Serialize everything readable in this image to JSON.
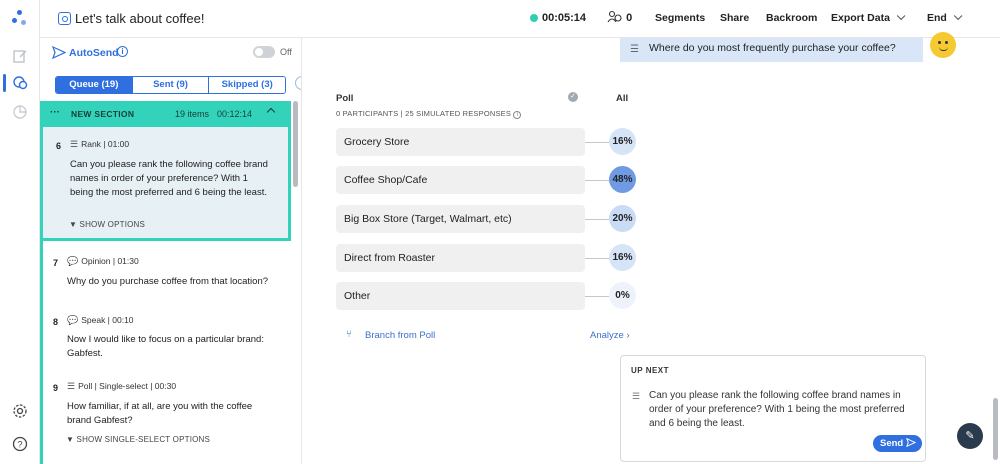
{
  "header": {
    "title": "Let's talk about coffee!",
    "timer": "00:05:14",
    "participants": "0",
    "nav": [
      "Segments",
      "Share",
      "Backroom",
      "Export Data",
      "End"
    ]
  },
  "autosend": {
    "label": "AutoSend",
    "toggle_label": "Off"
  },
  "tabs": [
    "Queue (19)",
    "Sent (9)",
    "Skipped (3)"
  ],
  "section": {
    "name": "NEW SECTION",
    "items": "19 items",
    "time": "00:12:14"
  },
  "questions": [
    {
      "num": "6",
      "meta": "Rank | 01:00",
      "text": "Can you please rank the following coffee brand names in order of your preference? With 1 being the most preferred and 6 being the least.",
      "options": "▼ SHOW OPTIONS"
    },
    {
      "num": "7",
      "meta": "Opinion | 01:30",
      "text": "Why do you purchase coffee from that location?"
    },
    {
      "num": "8",
      "meta": "Speak | 00:10",
      "text": "Now I would like to focus on a particular brand: Gabfest."
    },
    {
      "num": "9",
      "meta": "Poll | Single-select | 00:30",
      "text": "How familiar, if at all, are you with the coffee brand Gabfest?",
      "options": "▼ SHOW SINGLE-SELECT OPTIONS"
    }
  ],
  "chat": {
    "question": "Where do you most frequently purchase your coffee?"
  },
  "poll": {
    "label": "Poll",
    "all_label": "All",
    "subtitle": "0 PARTICIPANTS | 25 SIMULATED RESPONSES",
    "options": [
      {
        "label": "Grocery Store",
        "pct": "16%"
      },
      {
        "label": "Coffee Shop/Cafe",
        "pct": "48%"
      },
      {
        "label": "Big Box Store (Target, Walmart, etc)",
        "pct": "20%"
      },
      {
        "label": "Direct from Roaster",
        "pct": "16%"
      },
      {
        "label": "Other",
        "pct": "0%"
      }
    ],
    "branch_label": "Branch from Poll",
    "analyze_label": "Analyze"
  },
  "upnext": {
    "heading": "UP NEXT",
    "text": "Can you please rank the following coffee brand names in order of your preference? With 1 being the most preferred and 6 being the least.",
    "send_label": "Send"
  },
  "colors": {
    "accent": "#2f6fe0",
    "section": "#33d3bb",
    "active_question_bg": "#e7f0f5"
  }
}
